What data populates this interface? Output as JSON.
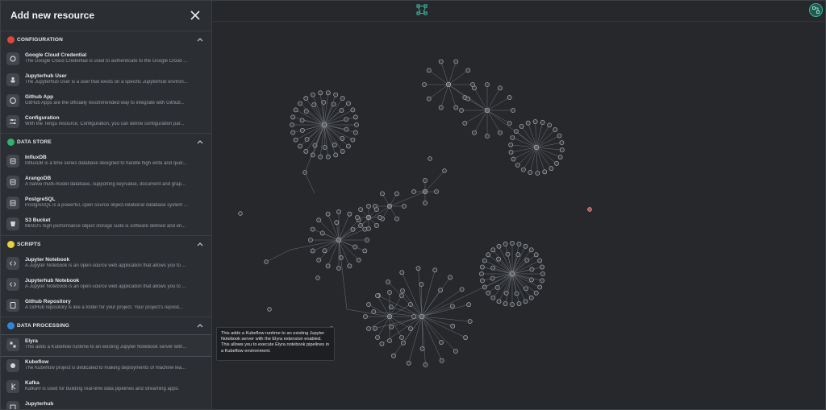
{
  "sidebar": {
    "title": "Add new resource",
    "sections": [
      {
        "label": "CONFIGURATION",
        "color": "#d9483b",
        "items": [
          {
            "name": "Google Cloud Credential",
            "desc": "The Google Cloud Credential is used to authenticate to the Google Cloud ...",
            "icon": "gear-cloud-icon"
          },
          {
            "name": "Jupyterhub User",
            "desc": "The Jupyterhub User is a user that exists on a specific Jupyterhub environ...",
            "icon": "user-icon"
          },
          {
            "name": "Github App",
            "desc": "GitHub Apps are the officially recommended way to integrate with Github...",
            "icon": "github-icon"
          },
          {
            "name": "Configuration",
            "desc": "With the Tengu resource, Configuration, you can define configuration par...",
            "icon": "sliders-icon"
          }
        ]
      },
      {
        "label": "DATA STORE",
        "color": "#2fb36b",
        "items": [
          {
            "name": "InfluxDB",
            "desc": "InfluxDB is a time series database designed to handle high write and quer...",
            "icon": "database-icon"
          },
          {
            "name": "ArangoDB",
            "desc": "A native multi-model database, supporting key/value, document and grap...",
            "icon": "database-icon"
          },
          {
            "name": "PostgreSQL",
            "desc": "PostgreSQL is a powerful, open source object-relational database system ...",
            "icon": "database-icon"
          },
          {
            "name": "S3 Bucket",
            "desc": "MinIO's high-performance object storage suite is software defined and en...",
            "icon": "bucket-icon"
          }
        ]
      },
      {
        "label": "SCRIPTS",
        "color": "#e8d23a",
        "items": [
          {
            "name": "Jupyter Notebook",
            "desc": "A Jupyter Notebook is an open-source web application that allows you to ...",
            "icon": "code-icon"
          },
          {
            "name": "Jupyterhub Notebook",
            "desc": "A Jupyter Notebook is an open-source web application that allows you to ...",
            "icon": "code-icon"
          },
          {
            "name": "Github Repository",
            "desc": "A GitHub repository is like a folder for your project. Your project's reposit...",
            "icon": "repo-icon"
          }
        ]
      },
      {
        "label": "DATA PROCESSING",
        "color": "#2f86d6",
        "items": [
          {
            "name": "Elyra",
            "desc": "This adds a Kubeflow runtime to an existing Jupyter Notebook server with...",
            "icon": "pipeline-icon"
          },
          {
            "name": "Kubeflow",
            "desc": "The Kubeflow project is dedicated to making deployments of machine lea...",
            "icon": "kubeflow-icon"
          },
          {
            "name": "Kafka",
            "desc": "Kafka® is used for building real-time data pipelines and streaming apps.",
            "icon": "kafka-icon"
          },
          {
            "name": "Jupyterhub",
            "desc": "",
            "icon": "server-icon"
          }
        ]
      }
    ]
  },
  "tooltip": {
    "text": "This adds a Kubeflow runtime to an existing Jupyter Notebook server with the Elyra extension enabled. This allows you to execute Elyra notebook pipelines in a Kubeflow environment."
  },
  "colors": {
    "accent": "#3bb39a",
    "canvas": "#26282c",
    "panel": "#2b2e32"
  }
}
